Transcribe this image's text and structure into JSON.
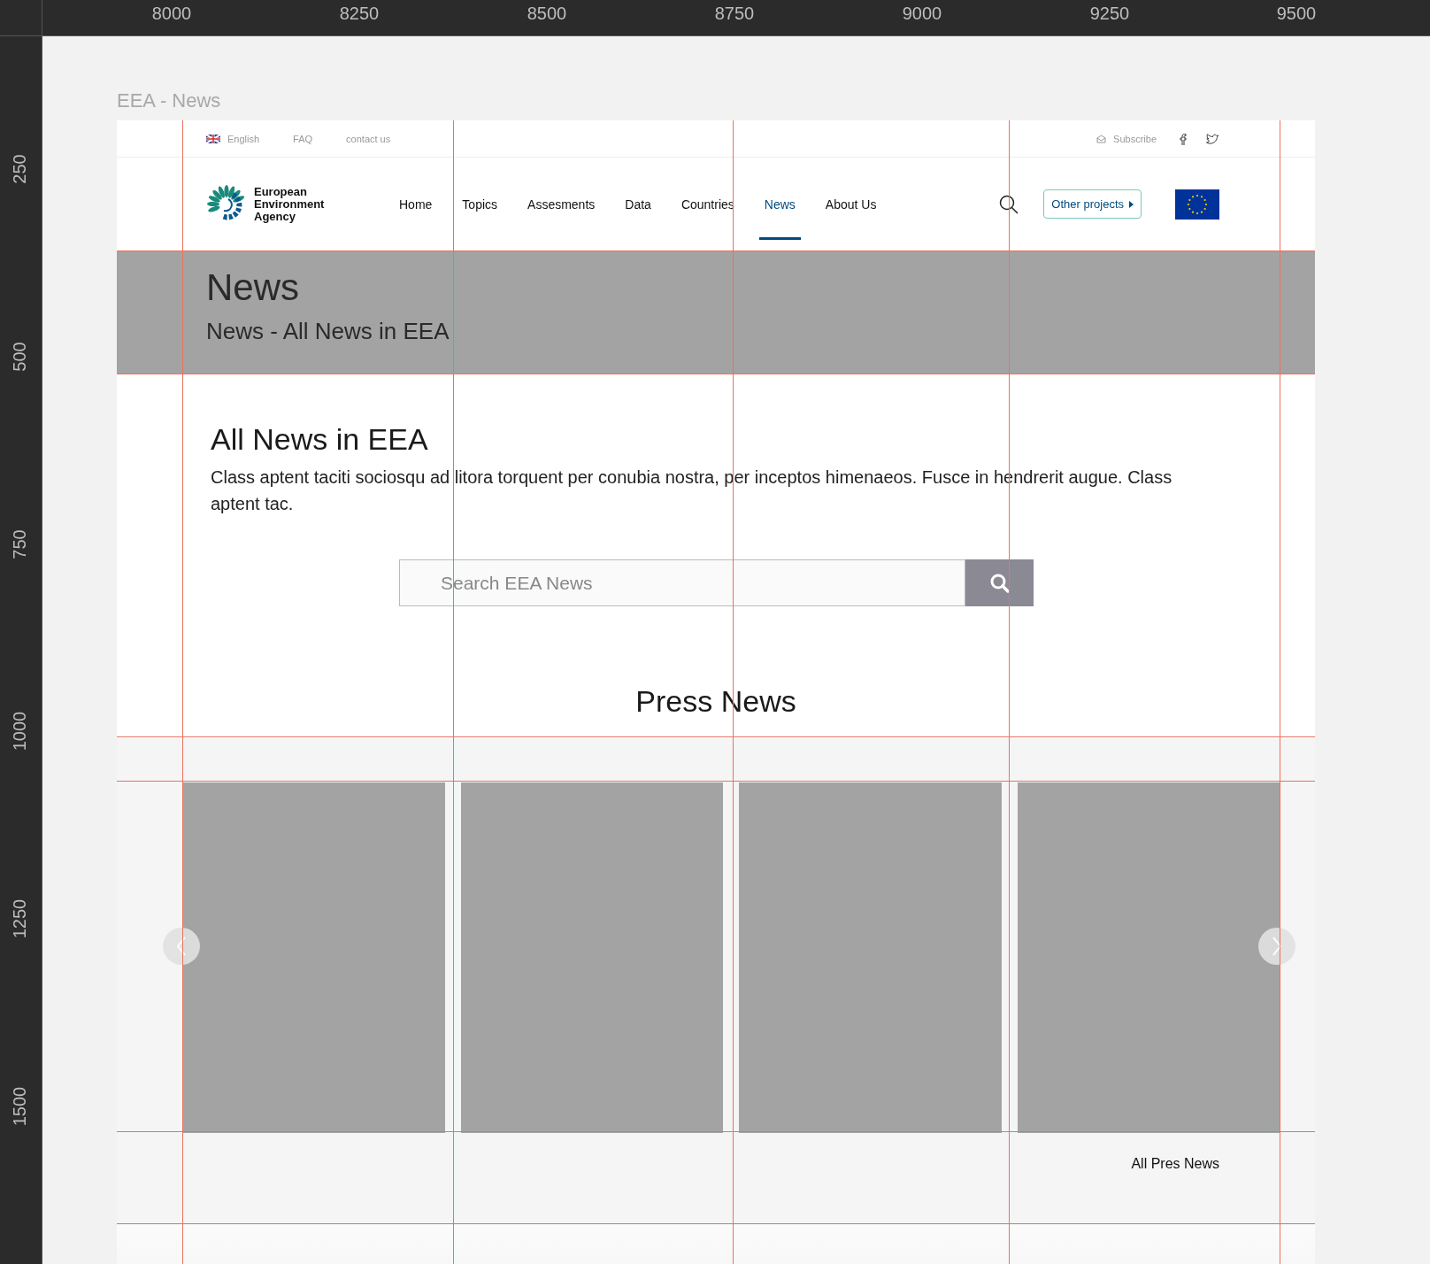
{
  "rulers": {
    "horizontal": [
      "8000",
      "8250",
      "8500",
      "8750",
      "9000",
      "9250",
      "9500"
    ],
    "vertical": [
      "250",
      "500",
      "750",
      "1000",
      "1250",
      "1500"
    ]
  },
  "artboard": {
    "title": "EEA - News"
  },
  "top_bar": {
    "language": "English",
    "links": [
      "FAQ",
      "contact us"
    ],
    "subscribe": "Subscribe"
  },
  "header": {
    "logo": [
      "European",
      "Environment",
      "Agency"
    ],
    "nav": [
      {
        "label": "Home",
        "selected": false
      },
      {
        "label": "Topics",
        "selected": false
      },
      {
        "label": "Assesments",
        "selected": false
      },
      {
        "label": "Data",
        "selected": false
      },
      {
        "label": "Countries",
        "selected": false
      },
      {
        "label": "News",
        "selected": true
      },
      {
        "label": "About Us",
        "selected": false
      }
    ],
    "other_projects": "Other projects"
  },
  "hero": {
    "title": "News",
    "subtitle": "News - All News in EEA"
  },
  "intro": {
    "heading": "All News in EEA",
    "text": "Class aptent taciti sociosqu ad litora torquent per conubia nostra, per inceptos himenaeos. Fusce in hendrerit augue. Class aptent tac."
  },
  "search": {
    "placeholder": "Search EEA News"
  },
  "press": {
    "heading": "Press News",
    "cards": [
      {
        "kind": "placeholder"
      },
      {
        "kind": "placeholder"
      },
      {
        "kind": "placeholder"
      },
      {
        "kind": "placeholder"
      }
    ],
    "all_link": "All Pres News"
  }
}
